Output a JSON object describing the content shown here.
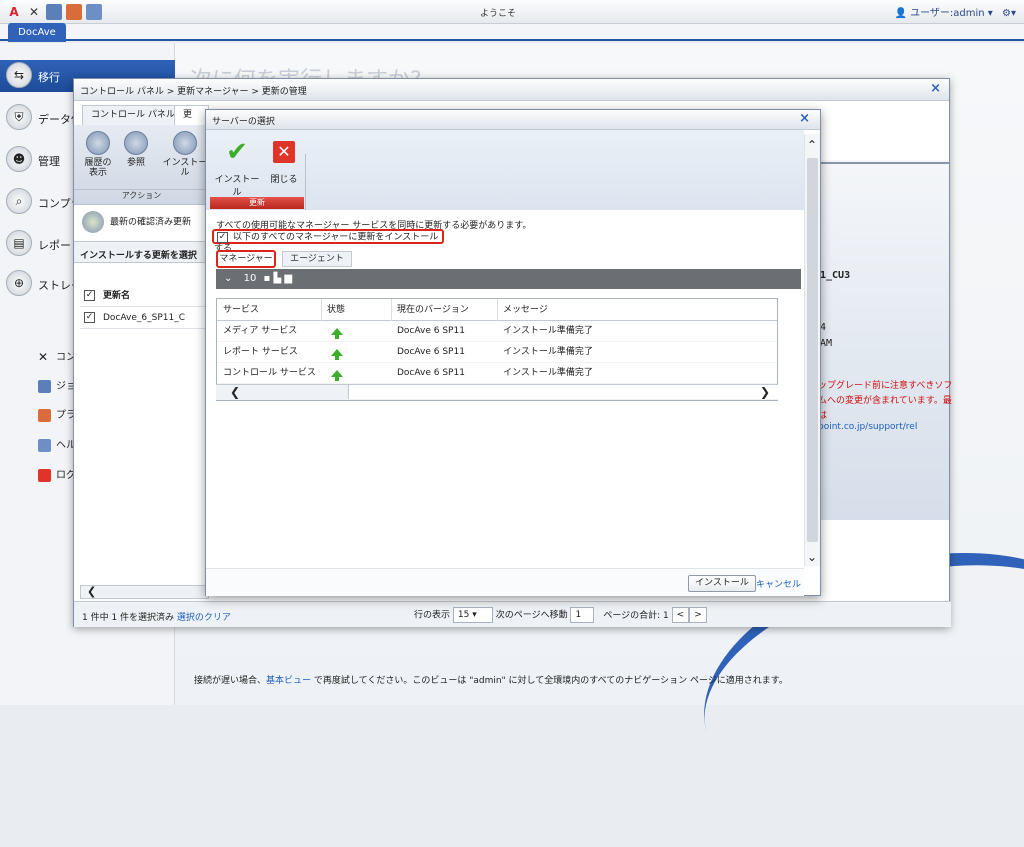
{
  "topbar": {
    "welcome": "ようこそ",
    "user": "ユーザー:admin ▾",
    "app_tab": "DocAve"
  },
  "nav": {
    "items": [
      {
        "label": "移行"
      },
      {
        "label": "データ保"
      },
      {
        "label": "管理"
      },
      {
        "label": "コンプラ"
      },
      {
        "label": "レポート"
      },
      {
        "label": "ストレー"
      }
    ],
    "sub": [
      {
        "label": "コン"
      },
      {
        "label": "ジョ"
      },
      {
        "label": "プラ"
      },
      {
        "label": "ヘル"
      },
      {
        "label": "ログ"
      }
    ]
  },
  "background": {
    "title": "次に何を実行しますか?",
    "footer_pre": "接続が遅い場合、",
    "footer_link": "基本ビュー",
    "footer_post": " で再度試してください。このビューは \"admin\" に対して全環境内のすべてのナビゲーション ページに適用されます。"
  },
  "main_dialog": {
    "breadcrumb": "コントロール パネル > 更新マネージャー > 更新の管理",
    "close": "×",
    "tabs": [
      "コントロール パネル",
      "更新"
    ],
    "ribbon": [
      {
        "label": "履歴の\n表示"
      },
      {
        "label": "参照"
      },
      {
        "label": "インストール"
      }
    ],
    "ribbon_group": "アクション",
    "latest": "最新の確認済み更新",
    "left_header": "インストールする更新を選択",
    "col_header": "更新名",
    "update_row": "DocAve_6_SP11_C",
    "status_left": "1 件中 1 件を選択済み",
    "clear_link": "選択のクリア",
    "rows_label": "行の表示",
    "rows_value": "15",
    "goto_label": "次のページへ移動",
    "goto_value": "1",
    "total_label": "ページの合計: 1"
  },
  "right_info": {
    "version": "1_CU3",
    "line2": "4",
    "line3": "AM",
    "warn1": "ップグレード前に注意すべきソフ",
    "warn2": "ムへの変更が含まれています。最",
    "warn3": "は",
    "link": "point.co.jp/support/rel"
  },
  "server_dialog": {
    "title": "サーバーの選択",
    "close": "×",
    "install_label": "インストール",
    "close_label": "閉じる",
    "group_label": "更新",
    "notice": "すべての使用可能なマネージャー サービスを同時に更新する必要があります。",
    "checkbox_label": "以下のすべてのマネージャーに更新をインストールする",
    "tab_manager": "マネージャー",
    "tab_agent": "エージェント",
    "page_size": "10",
    "columns": [
      "サービス",
      "状態",
      "現在のバージョン",
      "メッセージ"
    ],
    "rows": [
      {
        "service": "メディア サービス",
        "version": "DocAve 6 SP11",
        "message": "インストール準備完了"
      },
      {
        "service": "レポート サービス",
        "version": "DocAve 6 SP11",
        "message": "インストール準備完了"
      },
      {
        "service": "コントロール サービス",
        "version": "DocAve 6 SP11",
        "message": "インストール準備完了"
      }
    ],
    "footer_install": "インストール",
    "footer_cancel": "キャンセル"
  },
  "colors": {
    "accent": "#2f62b8",
    "highlight": "#d8261a",
    "ok": "#3cae2a"
  }
}
